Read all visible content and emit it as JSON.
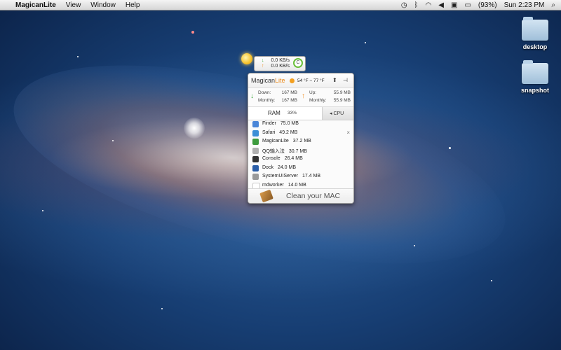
{
  "menubar": {
    "apple_icon": "apple-icon",
    "app_name": "MagicanLite",
    "menus": [
      "View",
      "Window",
      "Help"
    ],
    "battery": "(93%)",
    "clock": "Sun 2:23 PM"
  },
  "desktop": {
    "items": [
      {
        "label": "desktop",
        "icon": "folder-icon"
      },
      {
        "label": "snapshot",
        "icon": "folder-icon"
      }
    ]
  },
  "net_widget": {
    "down_speed": "0.0 KB/s",
    "up_speed": "0.0 KB/s"
  },
  "panel": {
    "brand_main": "Magican",
    "brand_accent": "Lite",
    "temperature": "54 °F ~ 77 °F",
    "stats": {
      "down_label": "Down:",
      "down_value": "167 MB",
      "up_label": "Up:",
      "up_value": "55.9 MB",
      "monthly_label": "Monthly:",
      "monthly_down": "167 MB",
      "monthly_up": "55.9 MB"
    },
    "tabs": {
      "ram_label": "RAM",
      "ram_percent": "33%",
      "cpu_label": "◂ CPU"
    },
    "processes": [
      {
        "name": "Finder",
        "mem": "75.0 MB",
        "color": "#4a86d8"
      },
      {
        "name": "Safari",
        "mem": "49.2 MB",
        "color": "#3c8fd6"
      },
      {
        "name": "MagicanLite",
        "mem": "37.2 MB",
        "color": "#3d9b3d"
      },
      {
        "name": "QQ输入法",
        "mem": "30.7 MB",
        "color": "#b0b0b0"
      },
      {
        "name": "Console",
        "mem": "26.4 MB",
        "color": "#333333"
      },
      {
        "name": "Dock",
        "mem": "24.0 MB",
        "color": "#2b5ea8"
      },
      {
        "name": "SystemUIServer",
        "mem": "17.4 MB",
        "color": "#9a9a9a"
      },
      {
        "name": "mdworker",
        "mem": "14.0 MB",
        "color": "#ffffff"
      }
    ],
    "close_symbol": "×",
    "clean_label": "Clean your MAC"
  }
}
